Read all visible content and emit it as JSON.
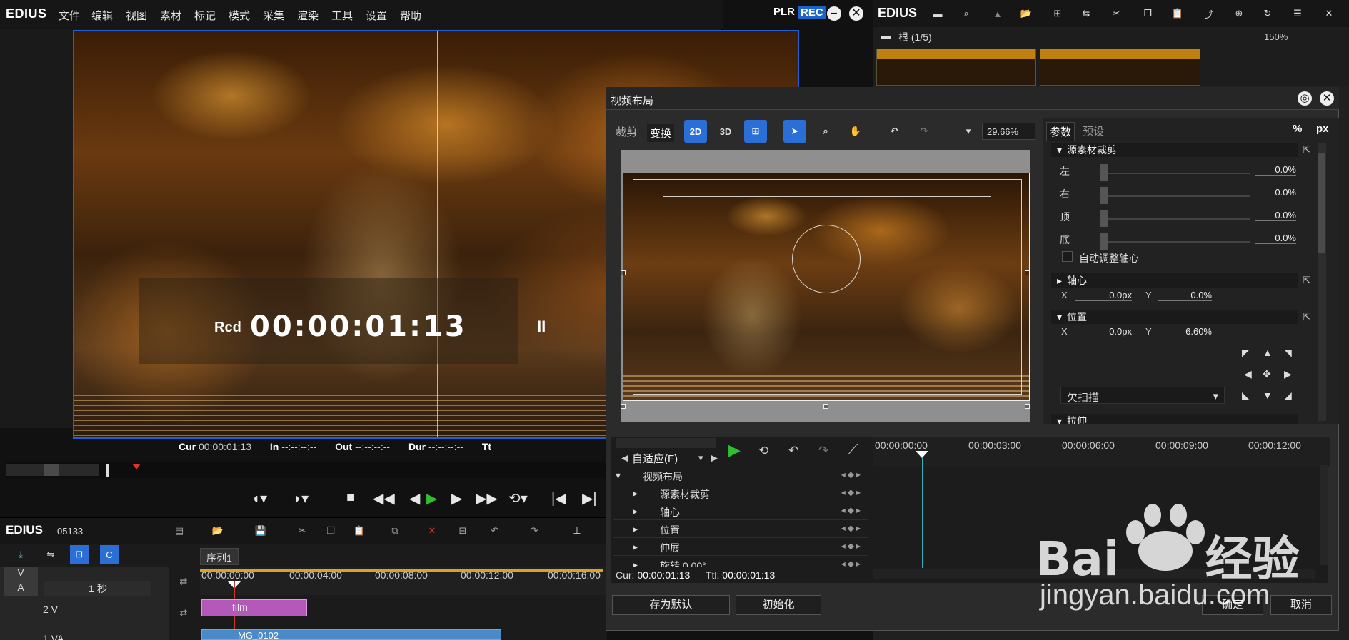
{
  "player": {
    "brand": "EDIUS",
    "menu": [
      "文件",
      "编辑",
      "视图",
      "素材",
      "标记",
      "模式",
      "采集",
      "渲染",
      "工具",
      "设置",
      "帮助"
    ],
    "plr": "PLR",
    "rec": "REC",
    "overlay": {
      "rcd": "Rcd",
      "timecode": "00:00:01:13",
      "pause": "II"
    },
    "readouts": {
      "cur_lbl": "Cur",
      "cur_val": "00:00:01:13",
      "in_lbl": "In",
      "in_val": "--:--:--:--",
      "out_lbl": "Out",
      "out_val": "--:--:--:--",
      "dur_lbl": "Dur",
      "dur_val": "--:--:--:--",
      "ttl_lbl": "Tt"
    }
  },
  "timeline": {
    "brand": "EDIUS",
    "project": "05133",
    "sequence_tab": "序列1",
    "v_label": "V",
    "a_label": "A",
    "zoom": "1 秒",
    "ruler": [
      "00:00:00:00",
      "00:00:04:00",
      "00:00:08:00",
      "00:00:12:00",
      "00:00:16:00"
    ],
    "tracks": [
      {
        "name": "2 V",
        "clip": "film"
      },
      {
        "name": "1 VA",
        "clip": "MG_0102"
      }
    ]
  },
  "bin": {
    "brand": "EDIUS",
    "path": "根 (1/5)",
    "zoom": "150%"
  },
  "dialog": {
    "title": "视频布局",
    "tabs": [
      "裁剪",
      "变换"
    ],
    "active_tab": "变换",
    "tools": {
      "mode_2d": "2D",
      "mode_3d": "3D"
    },
    "zoom": "29.66%",
    "param_tabs": [
      "参数",
      "预设"
    ],
    "units": {
      "percent": "%",
      "pixel": "px"
    },
    "sections": {
      "crop": {
        "title": "源素材裁剪",
        "rows": [
          {
            "label": "左",
            "value": "0.0%"
          },
          {
            "label": "右",
            "value": "0.0%"
          },
          {
            "label": "顶",
            "value": "0.0%"
          },
          {
            "label": "底",
            "value": "0.0%"
          }
        ],
        "auto_pivot": "自动调整轴心"
      },
      "pivot": {
        "title": "轴心",
        "x_label": "X",
        "x_value": "0.0px",
        "y_label": "Y",
        "y_value": "0.0%"
      },
      "position": {
        "title": "位置",
        "x_label": "X",
        "x_value": "0.0px",
        "y_label": "Y",
        "y_value": "-6.60%"
      },
      "scan": "欠扫描",
      "stretch": {
        "title": "拉伸"
      }
    },
    "keyframes": {
      "fit": "自适应(F)",
      "times": [
        "00:00:00:00",
        "00:00:03:00",
        "00:00:06:00",
        "00:00:09:00",
        "00:00:12:00"
      ],
      "rows": [
        "视频布局",
        "源素材裁剪",
        "轴心",
        "位置",
        "伸展",
        "旋转 0.00°"
      ],
      "cur_lbl": "Cur:",
      "cur_val": "00:00:01:13",
      "ttl_lbl": "Ttl:",
      "ttl_val": "00:00:01:13"
    },
    "buttons": {
      "save_default": "存为默认",
      "init": "初始化",
      "ok": "确定",
      "cancel": "取消"
    }
  },
  "watermark": {
    "logo": "Bai du 经验",
    "url": "jingyan.baidu.com"
  }
}
